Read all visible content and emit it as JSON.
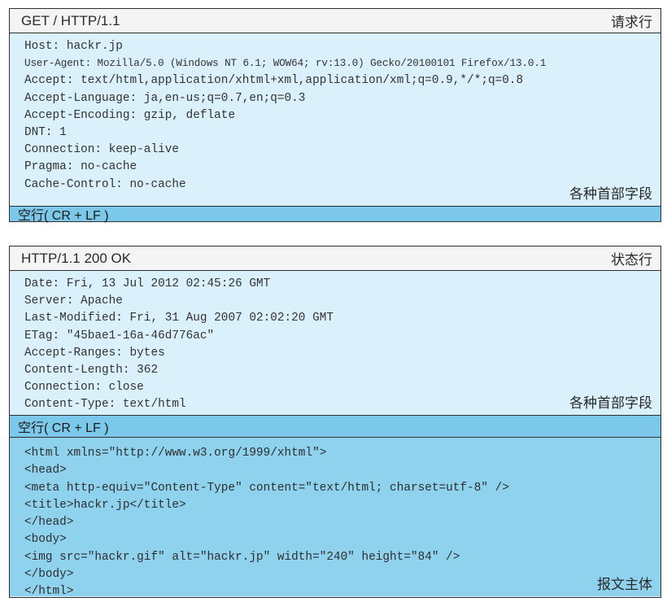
{
  "request": {
    "request_line": "GET / HTTP/1.1",
    "request_line_label": "请求行",
    "headers": [
      "Host: hackr.jp",
      "User-Agent: Mozilla/5.0 (Windows NT 6.1; WOW64; rv:13.0) Gecko/20100101 Firefox/13.0.1",
      "Accept: text/html,application/xhtml+xml,application/xml;q=0.9,*/*;q=0.8",
      "Accept-Language: ja,en-us;q=0.7,en;q=0.3",
      "Accept-Encoding: gzip, deflate",
      "DNT: 1",
      "Connection: keep-alive",
      "Pragma: no-cache",
      "Cache-Control: no-cache"
    ],
    "headers_label": "各种首部字段",
    "blank_line": "空行( CR + LF )"
  },
  "response": {
    "status_line": "HTTP/1.1 200 OK",
    "status_line_label": "状态行",
    "headers": [
      "Date: Fri, 13 Jul 2012 02:45:26 GMT",
      "Server: Apache",
      "Last-Modified: Fri, 31 Aug 2007 02:02:20 GMT",
      "ETag: \"45bae1-16a-46d776ac\"",
      "Accept-Ranges: bytes",
      "Content-Length: 362",
      "Connection: close",
      "Content-Type: text/html"
    ],
    "headers_label": "各种首部字段",
    "blank_line": "空行( CR + LF )",
    "body": [
      "<html xmlns=\"http://www.w3.org/1999/xhtml\">",
      "<head>",
      "<meta http-equiv=\"Content-Type\" content=\"text/html; charset=utf-8\" />",
      "<title>hackr.jp</title>",
      "</head>",
      "<body>",
      "<img src=\"hackr.gif\" alt=\"hackr.jp\" width=\"240\" height=\"84\" />",
      "</body>",
      "</html>"
    ],
    "body_label": "报文主体"
  }
}
